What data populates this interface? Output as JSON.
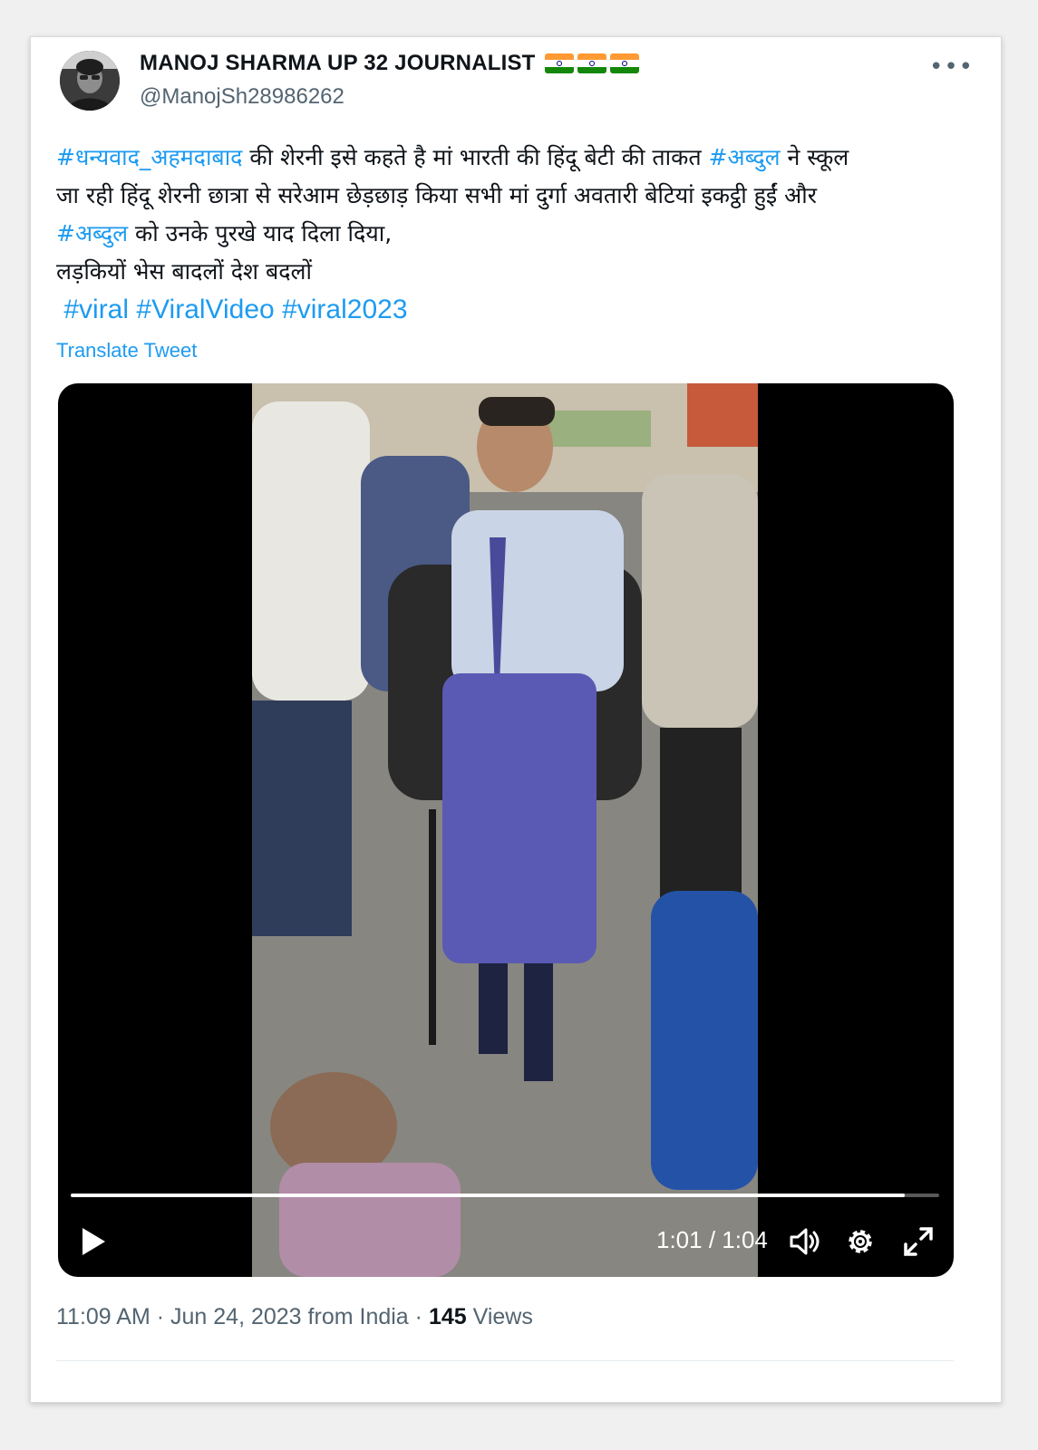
{
  "user": {
    "display_name": "MANOJ SHARMA UP 32 JOURNALIST",
    "handle": "@ManojSh28986262",
    "badges": [
      "india-flag",
      "india-flag",
      "india-flag"
    ]
  },
  "tweet": {
    "lines": [
      [
        {
          "text": "#धन्यवाद_अहमदाबाद",
          "hashtag": true
        },
        {
          "text": " की शेरनी इसे कहते है मां भारती की हिंदू बेटी की ताकत ",
          "hashtag": false
        },
        {
          "text": "#अब्दुल",
          "hashtag": true
        },
        {
          "text": " ने स्कूल",
          "hashtag": false
        }
      ],
      [
        {
          "text": "जा रही हिंदू शेरनी छात्रा से सरेआम छेड़छाड़ किया सभी मां दुर्गा अवतारी बेटियां इकट्ठी हुईं और",
          "hashtag": false
        }
      ],
      [
        {
          "text": "#अब्दुल",
          "hashtag": true
        },
        {
          "text": " को उनके पुरखे याद दिला दिया,",
          "hashtag": false
        }
      ],
      [
        {
          "text": "लड़कियों भेस बादलों देश बदलों",
          "hashtag": false
        }
      ]
    ],
    "hashtags_line": [
      "#viral",
      "#ViralVideo",
      "#viral2023"
    ],
    "translate_label": "Translate Tweet"
  },
  "video": {
    "progress_fraction": 0.96,
    "time_display": "1:01 / 1:04",
    "controls": [
      "play-icon",
      "volume-icon",
      "settings-icon",
      "fullscreen-icon"
    ]
  },
  "meta": {
    "time": "11:09 AM",
    "separator": "·",
    "date": "Jun 24, 2023",
    "from": "from India",
    "views_count": "145",
    "views_label": "Views"
  },
  "colors": {
    "link": "#1d9bf0",
    "secondary_text": "#536471",
    "primary_text": "#0f1419"
  }
}
